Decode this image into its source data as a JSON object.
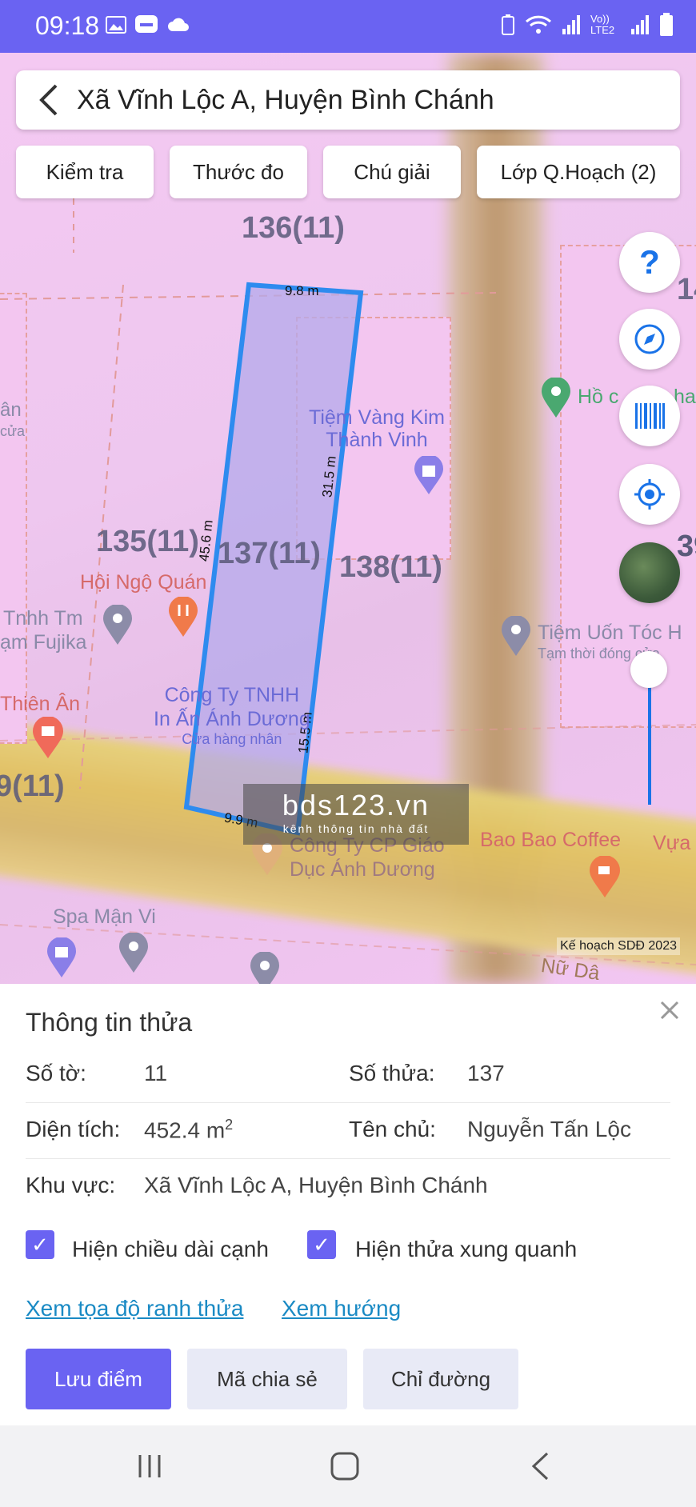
{
  "status": {
    "time": "09:18",
    "network": "Vo)) LTE2"
  },
  "header": {
    "title": "Xã Vĩnh Lộc A, Huyện Bình Chánh"
  },
  "toolbar": {
    "check": "Kiểm tra",
    "ruler": "Thước đo",
    "legend": "Chú giải",
    "layers": "Lớp Q.Hoạch (2)"
  },
  "map": {
    "parcels": {
      "p136": "136(11)",
      "p135": "135(11)",
      "p137": "137(11)",
      "p138": "138(11)",
      "p9": "9(11)",
      "p14": "14"
    },
    "edges": {
      "top": "9.8 m",
      "right": "31.5 m",
      "left": "45.6 m",
      "bottom": "9.9 m",
      "lower_right": "15.5 m"
    },
    "pois": {
      "jewelry1": "Tiệm Vàng Kim",
      "jewelry2": "Thành Vinh",
      "hoi": "Hội Ngộ Quán",
      "tnhh1": "Tnhh Tm",
      "tnhh2": "ạm Fujika",
      "an": "ân",
      "cua": "cửa",
      "thienan": "Thiên Ân",
      "cty1": "Công Ty TNHH",
      "cty2": "In Ấn Ánh Dương",
      "cty3": "Cửa hàng nhân",
      "giao1": "Công Ty CP Giáo",
      "giao2": "Dục Ánh Dương",
      "salon1": "Tiệm Uốn Tóc H",
      "salon2": "Tạm thời đóng cửa",
      "coffee": "Bao Bao Coffee",
      "vua": "Vựa",
      "spa": "Spa Mận Vi",
      "ho": "Hồ c",
      "ha": "ha",
      "n39": "39",
      "nu": "Nữ Dâ"
    },
    "watermark": {
      "main": "bds123.vn",
      "sub": "kênh thông tin nhà đất"
    },
    "layer_caption": "Kế hoạch SDĐ 2023",
    "accent": "#2e8bef"
  },
  "panel": {
    "title": "Thông tin thửa",
    "sheet_label": "Số tờ:",
    "sheet_value": "11",
    "parcel_label": "Số thửa:",
    "parcel_value": "137",
    "area_label": "Diện tích:",
    "area_value": "452.4 m",
    "area_unit_sup": "2",
    "owner_label": "Tên chủ:",
    "owner_value": "Nguyễn Tấn Lộc",
    "region_label": "Khu vực:",
    "region_value": "Xã Vĩnh Lộc A, Huyện Bình Chánh",
    "show_edges": "Hiện chiều dài cạnh",
    "show_neighbors": "Hiện thửa xung quanh",
    "link_coords": "Xem tọa độ ranh thửa",
    "link_direction": "Xem hướng",
    "btn_save": "Lưu điểm",
    "btn_share": "Mã chia sẻ",
    "btn_route": "Chỉ đường"
  },
  "colors": {
    "primary": "#6a63f2",
    "link": "#1a8ac4"
  }
}
